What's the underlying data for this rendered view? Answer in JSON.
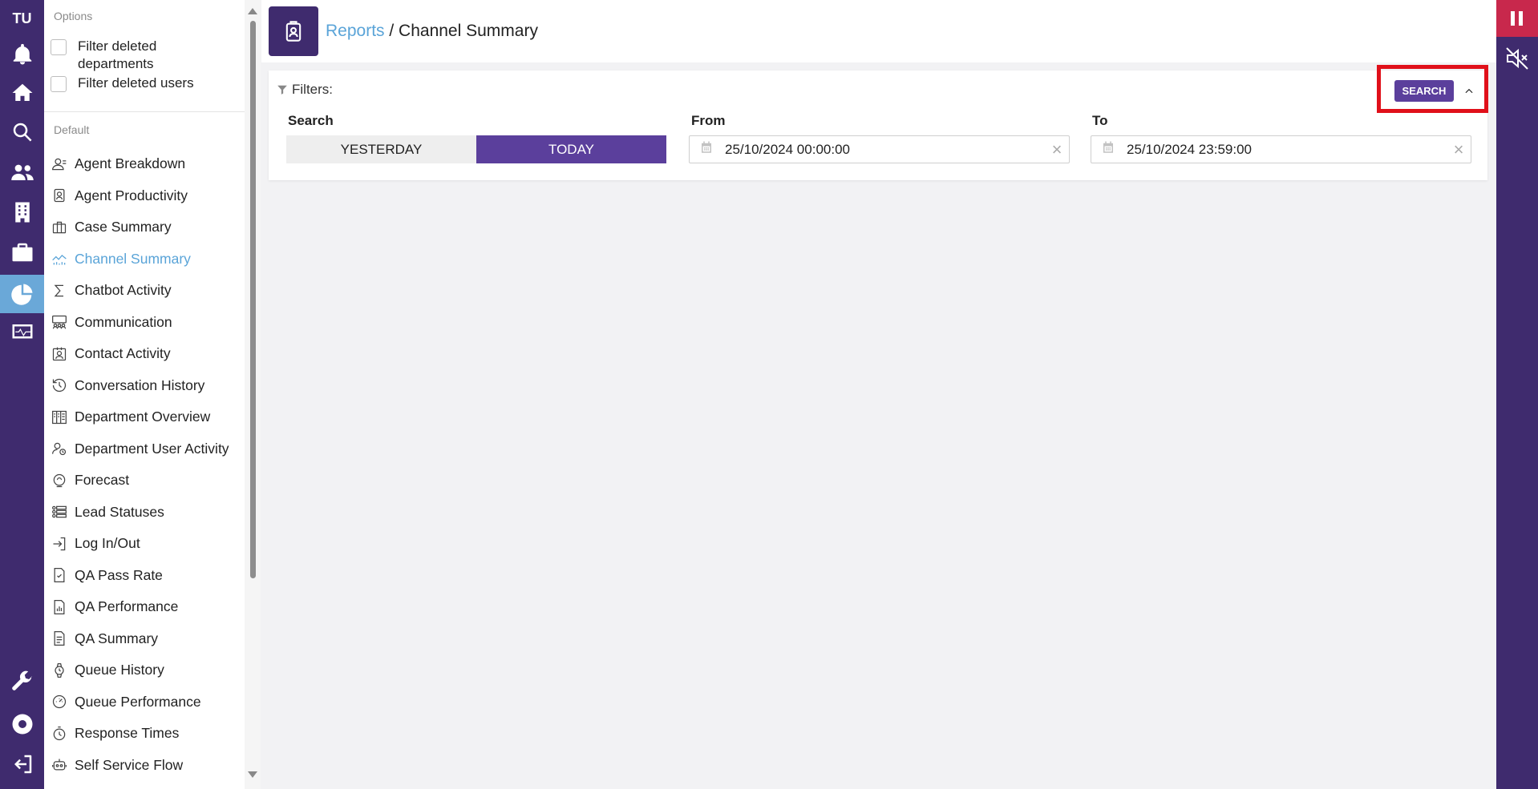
{
  "rail": {
    "avatar": "TU",
    "icons": [
      "bell-icon",
      "home-icon",
      "search-icon",
      "users-icon",
      "building-icon",
      "briefcase-icon",
      "pie-chart-icon",
      "monitor-icon",
      "wrench-icon",
      "lifebuoy-icon",
      "logout-icon"
    ],
    "active": "pie-chart-icon"
  },
  "sidebar": {
    "options_title": "Options",
    "options": [
      {
        "label": "Filter deleted departments",
        "checked": false
      },
      {
        "label": "Filter deleted users",
        "checked": false
      }
    ],
    "default_title": "Default",
    "reports": [
      {
        "label": "Agent Breakdown",
        "icon": "person-icon"
      },
      {
        "label": "Agent Productivity",
        "icon": "badge-icon"
      },
      {
        "label": "Case Summary",
        "icon": "briefcase-icon"
      },
      {
        "label": "Channel Summary",
        "icon": "chart-icon",
        "active": true
      },
      {
        "label": "Chatbot Activity",
        "icon": "sigma-icon"
      },
      {
        "label": "Communication",
        "icon": "group-icon"
      },
      {
        "label": "Contact Activity",
        "icon": "contact-card-icon"
      },
      {
        "label": "Conversation History",
        "icon": "history-icon"
      },
      {
        "label": "Department Overview",
        "icon": "building-icon"
      },
      {
        "label": "Department User Activity",
        "icon": "user-clock-icon"
      },
      {
        "label": "Forecast",
        "icon": "forecast-icon"
      },
      {
        "label": "Lead Statuses",
        "icon": "list-icon"
      },
      {
        "label": "Log In/Out",
        "icon": "login-icon"
      },
      {
        "label": "QA Pass Rate",
        "icon": "doc-check-icon"
      },
      {
        "label": "QA Performance",
        "icon": "doc-chart-icon"
      },
      {
        "label": "QA Summary",
        "icon": "doc-lines-icon"
      },
      {
        "label": "Queue History",
        "icon": "watch-icon"
      },
      {
        "label": "Queue Performance",
        "icon": "gauge-icon"
      },
      {
        "label": "Response Times",
        "icon": "stopwatch-icon"
      },
      {
        "label": "Self Service Flow",
        "icon": "robot-icon"
      }
    ]
  },
  "header": {
    "crumb_link": "Reports",
    "separator": " / ",
    "page_title": "Channel Summary"
  },
  "filters": {
    "title": "Filters:",
    "search_label": "Search",
    "yesterday": "YESTERDAY",
    "today": "TODAY",
    "selected": "TODAY",
    "from_label": "From",
    "from_value": "25/10/2024 00:00:00",
    "to_label": "To",
    "to_value": "25/10/2024 23:59:00",
    "search_button": "SEARCH"
  },
  "colors": {
    "brand": "#3f2b6e",
    "accent": "#5b3f9c",
    "link": "#5aa4d8",
    "alert": "#c8284c",
    "highlight": "#e0101a"
  }
}
